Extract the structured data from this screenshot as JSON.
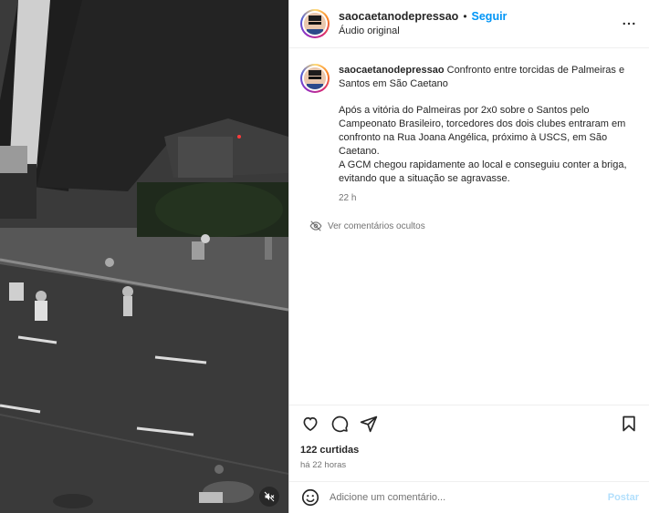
{
  "header": {
    "username": "saocaetanodepressao",
    "separator": "•",
    "follow_label": "Seguir",
    "audio_label": "Áudio original",
    "more_icon": "more-horizontal-icon"
  },
  "caption": {
    "username": "saocaetanodepressao",
    "title": "Confronto entre torcidas de Palmeiras e Santos em São Caetano",
    "paragraph1": "Após a vitória do Palmeiras por 2x0 sobre o Santos pelo Campeonato Brasileiro, torcedores dos dois clubes entraram em confronto na Rua Joana Angélica, próximo à USCS, em São Caetano.",
    "paragraph2": "A GCM chegou rapidamente ao local e conseguiu conter a briga, evitando que a situação se agravasse.",
    "time": "22 h"
  },
  "hidden_comments_label": "Ver comentários ocultos",
  "actions": {
    "like_icon": "heart-icon",
    "comment_icon": "comment-icon",
    "share_icon": "share-icon",
    "save_icon": "bookmark-icon",
    "likes_text": "122 curtidas",
    "ago_text": "há 22 horas"
  },
  "comment_box": {
    "placeholder": "Adicione um comentário...",
    "post_label": "Postar"
  },
  "video": {
    "muted": true,
    "mute_icon": "speaker-muted-icon"
  }
}
